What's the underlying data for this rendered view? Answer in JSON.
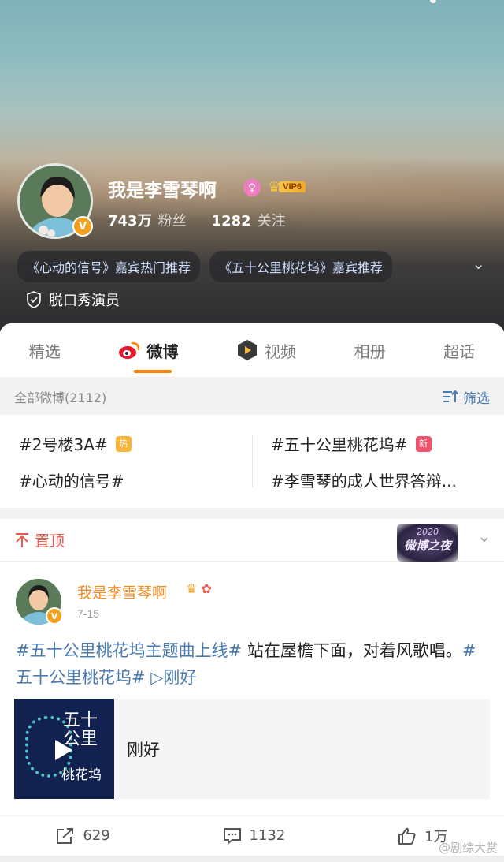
{
  "profile": {
    "name": "我是李雪琴啊",
    "vip_tag": "VIP6",
    "fans_count": "743万",
    "fans_label": "粉丝",
    "following_count": "1282",
    "following_label": "关注",
    "recommendations": [
      "《心动的信号》嘉宾热门推荐",
      "《五十公里桃花坞》嘉宾推荐"
    ],
    "verified_tag": "脱口秀演员",
    "colors": {
      "accent": "#ff8200",
      "link": "#4a7bb0",
      "vip": "#f0a92a"
    }
  },
  "tabs": [
    {
      "label": "精选"
    },
    {
      "label": "微博",
      "active": true
    },
    {
      "label": "视频"
    },
    {
      "label": "相册"
    },
    {
      "label": "超话"
    }
  ],
  "filter": {
    "all_label": "全部微博(2112)",
    "sort_label": "筛选"
  },
  "topics": [
    {
      "text": "#2号楼3A#",
      "badge": "热"
    },
    {
      "text": "#五十公里桃花坞#",
      "badge": "新"
    },
    {
      "text": "#心动的信号#"
    },
    {
      "text": "#李雪琴的成人世界答辩..."
    }
  ],
  "pinned": {
    "label": "置顶",
    "logo_year": "2020",
    "logo_text": "微博之夜"
  },
  "post": {
    "author": "我是李雪琴啊",
    "time": "7-15",
    "text_link1": "#五十公里桃花坞主题曲上线#",
    "text_plain1": " 站在屋檐下面，对着风歌唱。",
    "text_link2": "#五十公里桃花坞#",
    "text_link3": " ▷刚好",
    "cover_title": "五十\n公里",
    "cover_sub": "桃花坞",
    "song": "刚好",
    "reposts": "629",
    "comments": "1132",
    "likes": "1万"
  },
  "watermark": "@剧综大赏"
}
